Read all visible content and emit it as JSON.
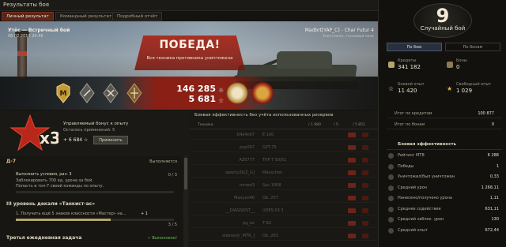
{
  "window": {
    "title": "Результаты боя",
    "close": "✕"
  },
  "tabs": [
    {
      "label": "Личный результат",
      "active": true
    },
    {
      "label": "Командный результат",
      "active": false
    },
    {
      "label": "Подробный отчёт",
      "active": false
    }
  ],
  "banner": {
    "map": "Утёс — Встречный бой",
    "date": "06.02.2016 20:46",
    "result": "ПОБЕДА!",
    "result_sub": "Вся техника противника уничтожена",
    "player": "Madbrt[YAP_C] - Char Futur 4",
    "vehicle": "Уничтожен, танковый полк",
    "credits": "146 285",
    "xp": "5 681",
    "credit_icon": "☼",
    "xp_icon": "☆"
  },
  "bonus": {
    "multiplier": "x3",
    "title": "Управляемый бонус к опыту",
    "remaining": "Осталось применений: 5",
    "xp_value": "+ 6 684",
    "xp_icon": "☆",
    "apply_label": "Применить"
  },
  "tasks": {
    "task1": {
      "code": "Д-7",
      "status": "Выполняется",
      "condition": "Выполнить условия, раз: 3",
      "desc1": "Заблокировать 700 ед. урона за бой.",
      "desc2": "Попасть в топ-7 своей команды по опыту.",
      "progress": "0 / 3",
      "fraction": 0
    },
    "task2": {
      "title": "III уровень декали «Танкист-ас»",
      "item": "1. Получить ещё 5 знаков классности «Мастер» на...",
      "delta": "+ 1",
      "progress": "3 / 5",
      "fraction": 0.6
    },
    "task3": {
      "title": "Третья ежедневная задача",
      "status": "✓ Выполнено!"
    }
  },
  "team": {
    "header": "Боевая эффективность без учёта использованных резервов",
    "cols": [
      "Техника",
      "/ 1 980",
      "/ 5",
      "/ 5 851"
    ],
    "rows": [
      {
        "name": "D4k4n07",
        "vehicle": "E 100"
      },
      {
        "name": "pup007",
        "vehicle": "GPT-75"
      },
      {
        "name": "AZ0777",
        "vehicle": "TVP T 50/51"
      },
      {
        "name": "qwerty2k[Z_G]",
        "vehicle": "Mäuschen"
      },
      {
        "name": "mrzed3",
        "vehicle": "Sav 1808"
      },
      {
        "name": "Maxyan46",
        "vehicle": "Ob. 257"
      },
      {
        "name": "__DIAGNOST__",
        "vehicle": "UDES 03 3"
      },
      {
        "name": "pg_ex",
        "vehicle": "Т-62"
      },
      {
        "name": "aleksey[r_MTR_]",
        "vehicle": "Ob. 263"
      }
    ]
  },
  "right": {
    "tier": "9",
    "battle_type": "Случайный бой",
    "tabs": [
      {
        "label": "По бою",
        "active": true
      },
      {
        "label": "По бонам",
        "active": false
      }
    ],
    "credits_label": "Кредиты",
    "credits": "341 182",
    "bonds_label": "Боны",
    "bonds": "0",
    "xp_label": "Боевой опыт",
    "xp": "11 420",
    "free_xp_label": "Свободный опыт",
    "free_xp": "1 029",
    "totals": [
      {
        "label": "Итог по кредитам",
        "value": "100 877"
      },
      {
        "label": "Итог по бонам",
        "value": "0"
      }
    ],
    "efficiency_header": "Боевая эффективность",
    "efficiency": [
      {
        "label": "Рейтинг МТВ",
        "value": "6 288"
      },
      {
        "label": "Победы",
        "value": "1"
      },
      {
        "label": "Уничтожил/был уничтожен",
        "value": "0,33"
      },
      {
        "label": "Средний урон",
        "value": "1 268,11"
      },
      {
        "label": "Нанесено/получено урона",
        "value": "1,11"
      },
      {
        "label": "Среднее содействие",
        "value": "631,11"
      },
      {
        "label": "Средний заблок. урон",
        "value": "130"
      },
      {
        "label": "Средний опыт",
        "value": "672,44"
      }
    ]
  },
  "colors": {
    "accent_red": "#8f2114",
    "gold": "#d8b25a",
    "panel": "#1a1915"
  }
}
